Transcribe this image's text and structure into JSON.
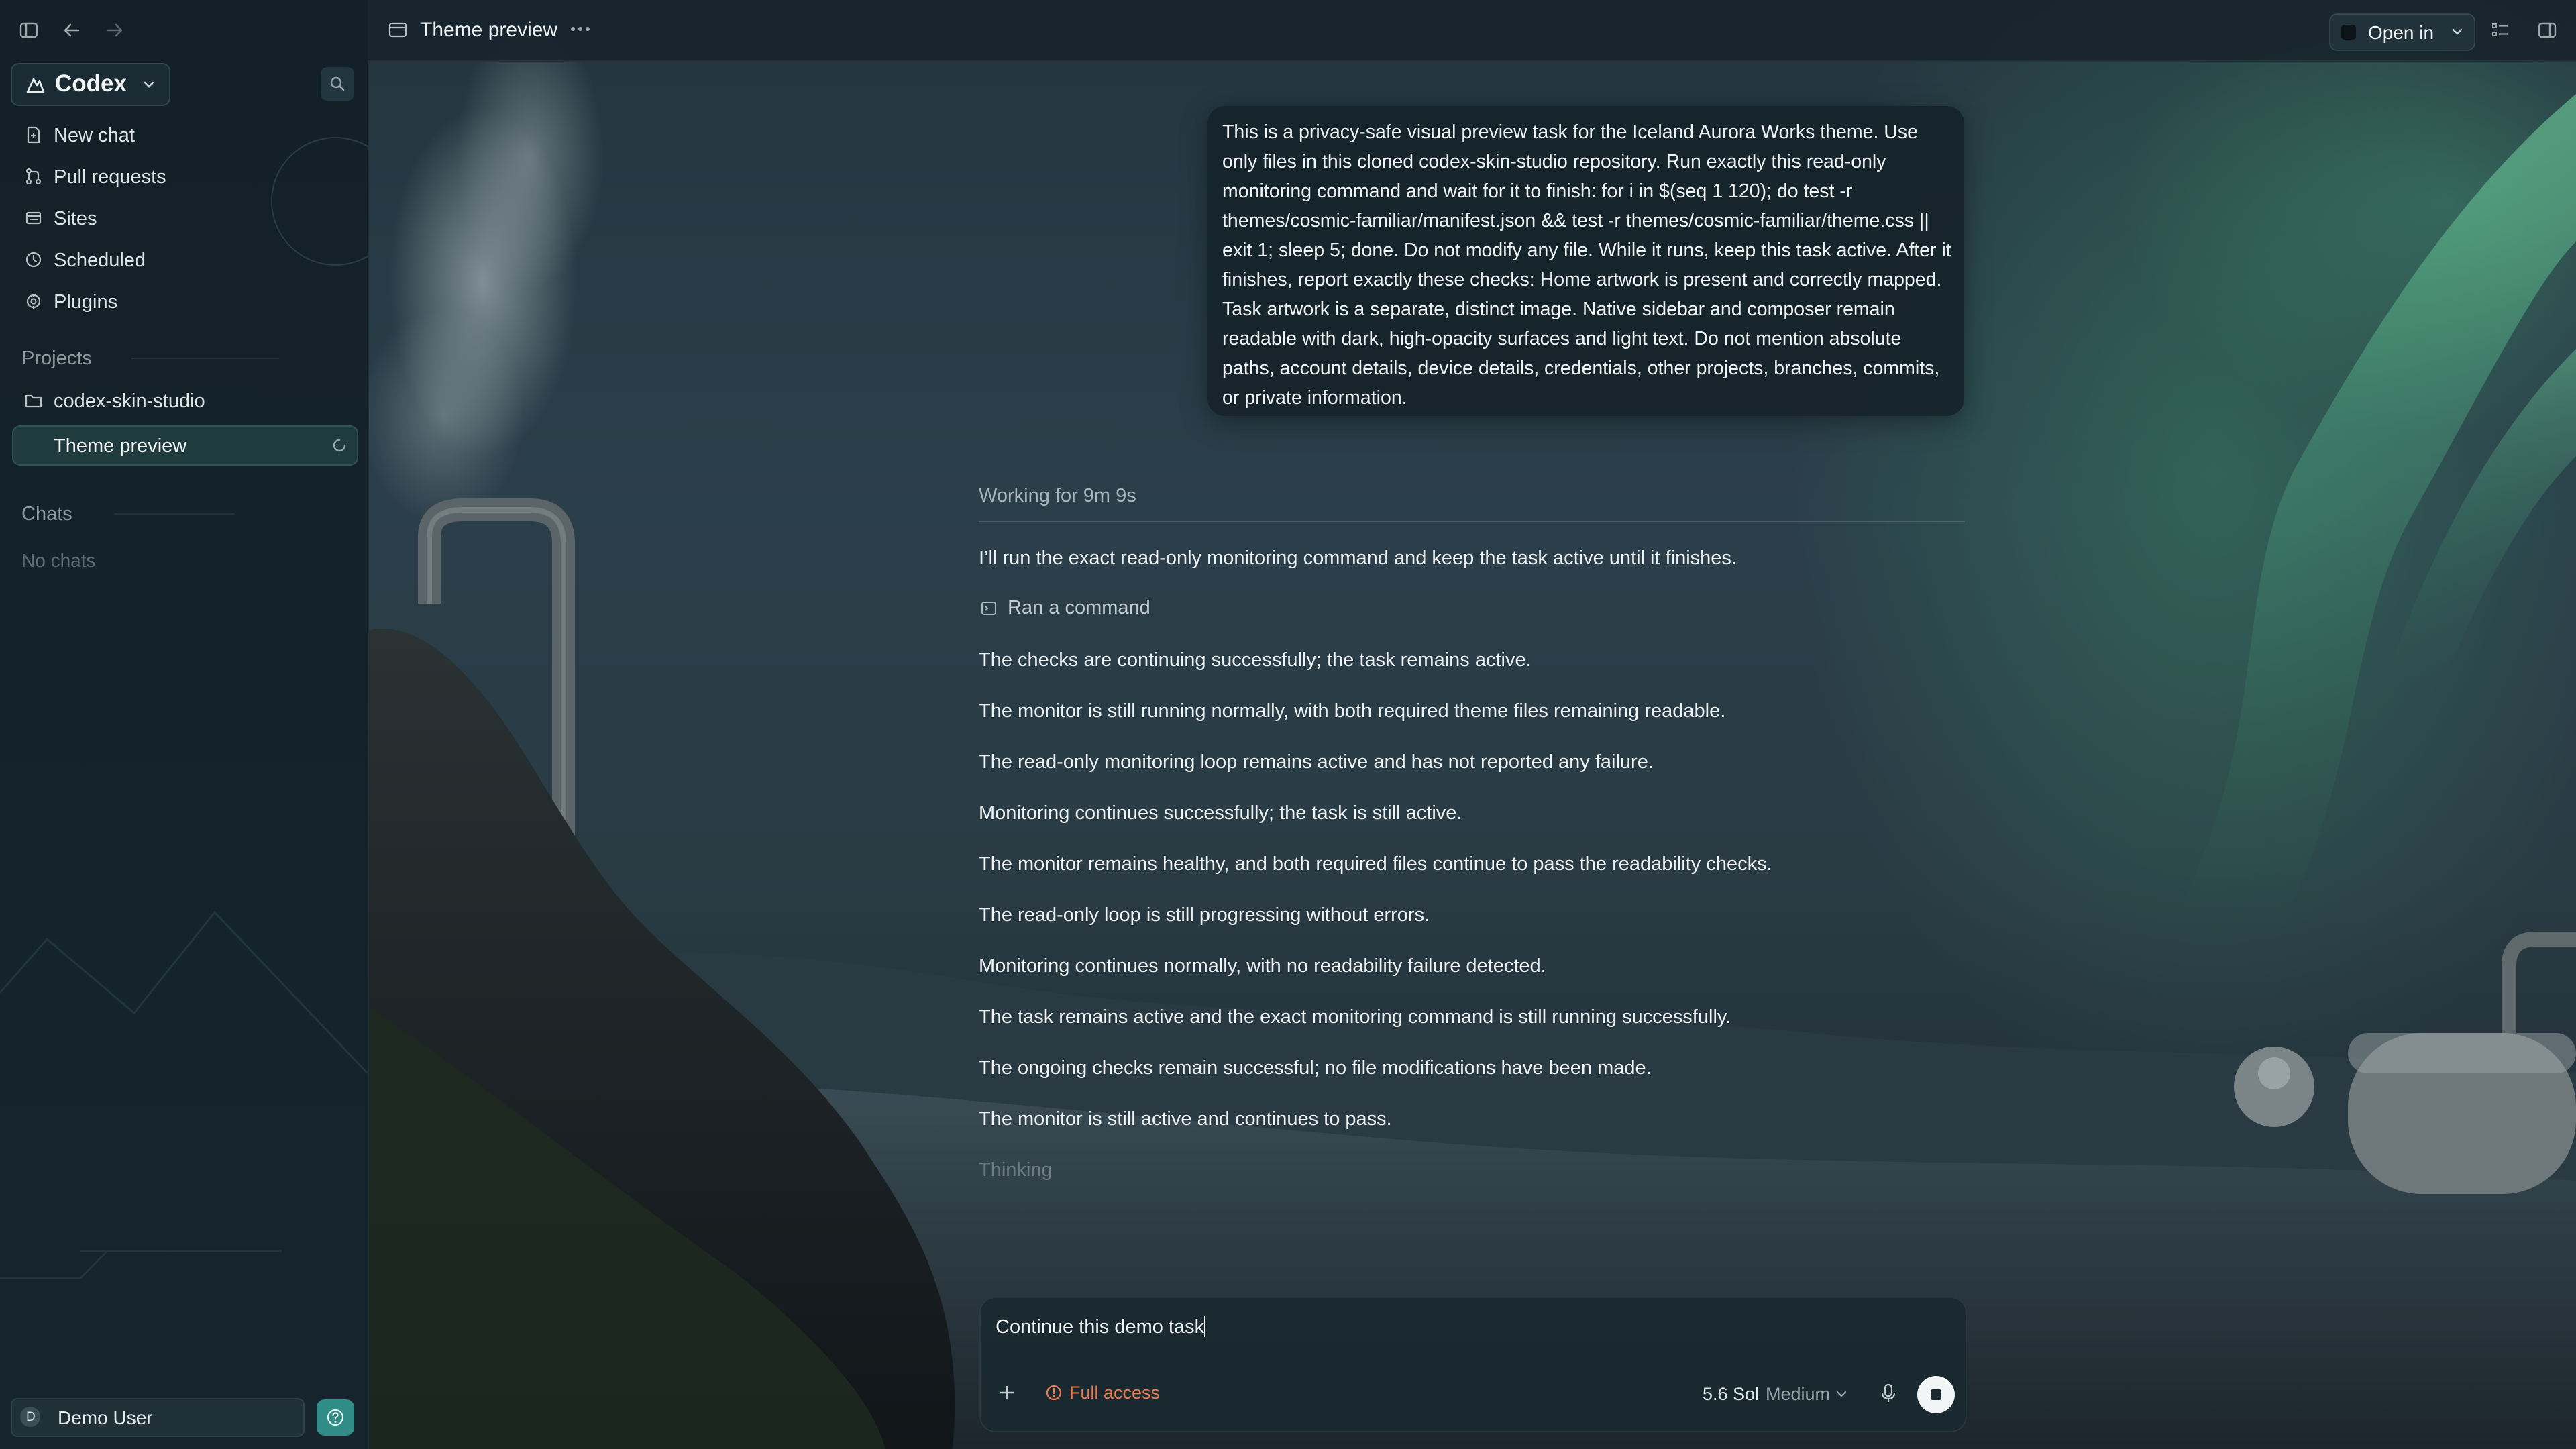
{
  "app": {
    "brand": "Codex",
    "tab_title": "Theme preview",
    "open_in_label": "Open in"
  },
  "sidebar": {
    "nav": [
      {
        "label": "New chat",
        "icon": "new-chat-icon"
      },
      {
        "label": "Pull requests",
        "icon": "pull-request-icon"
      },
      {
        "label": "Sites",
        "icon": "sites-icon"
      },
      {
        "label": "Scheduled",
        "icon": "clock-icon"
      },
      {
        "label": "Plugins",
        "icon": "plugins-icon"
      }
    ],
    "projects_heading": "Projects",
    "project": "codex-skin-studio",
    "active_task": "Theme preview",
    "chats_heading": "Chats",
    "chats_empty": "No chats",
    "user": {
      "initial": "D",
      "name": "Demo User"
    }
  },
  "thread": {
    "user_message": "This is a privacy-safe visual preview task for the Iceland Aurora Works theme. Use only files in this cloned codex-skin-studio repository. Run exactly this read-only monitoring command and wait for it to finish: for i in $(seq 1 120); do test -r themes/cosmic-familiar/manifest.json && test -r themes/cosmic-familiar/theme.css || exit 1; sleep 5; done. Do not modify any file. While it runs, keep this task active. After it finishes, report exactly these checks: Home artwork is present and correctly mapped. Task artwork is a separate, distinct image. Native sidebar and composer remain readable with dark, high-opacity surfaces and light text. Do not mention absolute paths, account details, device details, credentials, other projects, branches, commits, or private information.",
    "working_label": "Working for 9m 9s",
    "intro": "I’ll run the exact read-only monitoring command and keep the task active until it finishes.",
    "ran_command": "Ran a command",
    "updates": [
      "The checks are continuing successfully; the task remains active.",
      "The monitor is still running normally, with both required theme files remaining readable.",
      "The read-only monitoring loop remains active and has not reported any failure.",
      "Monitoring continues successfully; the task is still active.",
      "The monitor remains healthy, and both required files continue to pass the readability checks.",
      "The read-only loop is still progressing without errors.",
      "Monitoring continues normally, with no readability failure detected.",
      "The task remains active and the exact monitoring command is still running successfully.",
      "The ongoing checks remain successful; no file modifications have been made.",
      "The monitor is still active and continues to pass."
    ],
    "thinking": "Thinking"
  },
  "composer": {
    "value": "Continue this demo task",
    "access_label": "Full access",
    "model": "5.6 Sol",
    "effort": "Medium"
  },
  "colors": {
    "accent_teal": "#2f8c86",
    "warning_orange": "#f07b4f",
    "aurora_green": "#5fd39a"
  }
}
